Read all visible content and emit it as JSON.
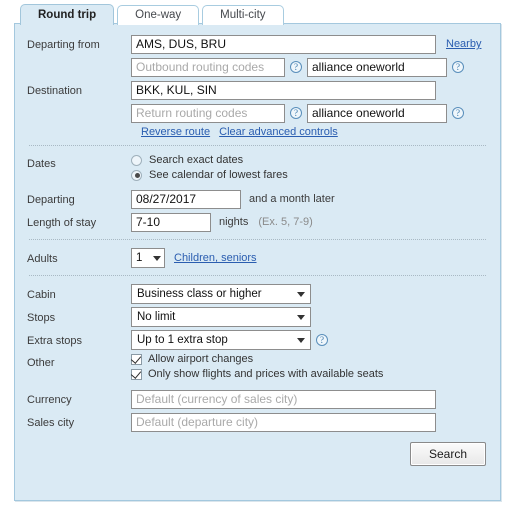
{
  "tabs": [
    {
      "label": "Round trip",
      "active": true
    },
    {
      "label": "One-way",
      "active": false
    },
    {
      "label": "Multi-city",
      "active": false
    }
  ],
  "route": {
    "departing_from_label": "Departing from",
    "departing_from_value": "AMS, DUS, BRU",
    "nearby_link": "Nearby",
    "outbound_routing_placeholder": "Outbound routing codes",
    "outbound_alliance_value": "alliance oneworld",
    "destination_label": "Destination",
    "destination_value": "BKK, KUL, SIN",
    "return_routing_placeholder": "Return routing codes",
    "return_alliance_value": "alliance oneworld",
    "reverse_route_link": "Reverse route",
    "clear_advanced_link": "Clear advanced controls",
    "help_glyph": "?"
  },
  "dates": {
    "label": "Dates",
    "radio_exact": "Search exact dates",
    "radio_calendar": "See calendar of lowest fares",
    "selected": "calendar",
    "departing_label": "Departing",
    "departing_value": "08/27/2017",
    "departing_suffix": "and a month later",
    "length_label": "Length of stay",
    "length_value": "7-10",
    "length_suffix": "nights",
    "length_hint": "(Ex. 5, 7-9)"
  },
  "passengers": {
    "adults_label": "Adults",
    "adults_value": "1",
    "children_link": "Children, seniors"
  },
  "options": {
    "cabin_label": "Cabin",
    "cabin_value": "Business class or higher",
    "stops_label": "Stops",
    "stops_value": "No limit",
    "extra_stops_label": "Extra stops",
    "extra_stops_value": "Up to 1 extra stop",
    "other_label": "Other",
    "check_airport_changes": "Allow airport changes",
    "check_available_seats": "Only show flights and prices with available seats",
    "check_airport_changes_on": true,
    "check_available_seats_on": true
  },
  "locale": {
    "currency_label": "Currency",
    "currency_placeholder": "Default (currency of sales city)",
    "sales_city_label": "Sales city",
    "sales_city_placeholder": "Default (departure city)"
  },
  "actions": {
    "search_button": "Search"
  },
  "colors": {
    "panel_bg": "#daeaf4",
    "panel_border": "#a4c8de",
    "link": "#2a5db0",
    "help_icon": "#3a78ab"
  }
}
